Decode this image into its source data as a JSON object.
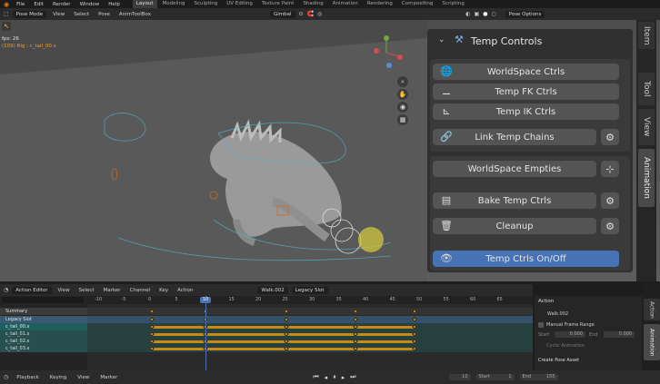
{
  "menubar": {
    "menus": [
      "File",
      "Edit",
      "Render",
      "Window",
      "Help"
    ],
    "workspaces": [
      "Layout",
      "Modeling",
      "Sculpting",
      "UV Editing",
      "Texture Paint",
      "Shading",
      "Animation",
      "Rendering",
      "Compositing",
      "Scripting"
    ],
    "active_workspace": "Layout"
  },
  "viewport_header": {
    "mode": "Pose Mode",
    "menus": [
      "View",
      "Select",
      "Pose",
      "AnimToolBox"
    ],
    "orientation": "Gimbal",
    "pose_options": "Pose Options"
  },
  "viewport": {
    "overlay_line1": "fps: 26",
    "overlay_line2": "(109) Rig : c_tail_00.x"
  },
  "npanel": {
    "title": "Temp Controls",
    "buttons": {
      "worldspace_ctrls": "WorldSpace Ctrls",
      "temp_fk": "Temp FK Ctrls",
      "temp_ik": "Temp IK Ctrls",
      "link_chains": "Link Temp Chains",
      "worldspace_empties": "WorldSpace Empties",
      "bake": "Bake Temp Ctrls",
      "cleanup": "Cleanup",
      "onoff": "Temp Ctrls On/Off"
    }
  },
  "side_tabs": [
    "Item",
    "Tool",
    "View",
    "Animation"
  ],
  "action_editor": {
    "editor": "Action Editor",
    "menus": [
      "View",
      "Select",
      "Marker",
      "Channel",
      "Key",
      "Action"
    ],
    "action_name": "Walk.002",
    "slot": "Legacy Slot",
    "current_frame": 10,
    "ruler": [
      -10,
      -5,
      0,
      5,
      10,
      15,
      20,
      25,
      30,
      35,
      40,
      45,
      50,
      55,
      60,
      65
    ],
    "channels": [
      "Summary",
      "Legacy Slot",
      "c_tail_00.x",
      "c_tail_01.x",
      "c_tail_02.x",
      "c_tail_03.x"
    ],
    "key_frames": [
      0,
      10,
      25,
      38,
      49
    ]
  },
  "props_panel": {
    "section": "Action",
    "action_name": "Walk.002",
    "manual_range": "Manual Frame Range",
    "start_label": "Start",
    "start_value": "0.000",
    "end_label": "End",
    "end_value": "0.000",
    "cyclic": "Cyclic Animation",
    "create_pose": "Create Pose Asset"
  },
  "props_tabs": [
    "Action",
    "Animation"
  ],
  "statusbar": {
    "menus": [
      "Playback",
      "Keying",
      "View",
      "Marker"
    ],
    "frame": "10",
    "start_label": "Start",
    "start_value": "1",
    "end_label": "End",
    "end_value": "155"
  },
  "colors": {
    "accent": "#4772b3",
    "keyframe": "#e3a319",
    "timeline_cursor": "#4772b3"
  }
}
